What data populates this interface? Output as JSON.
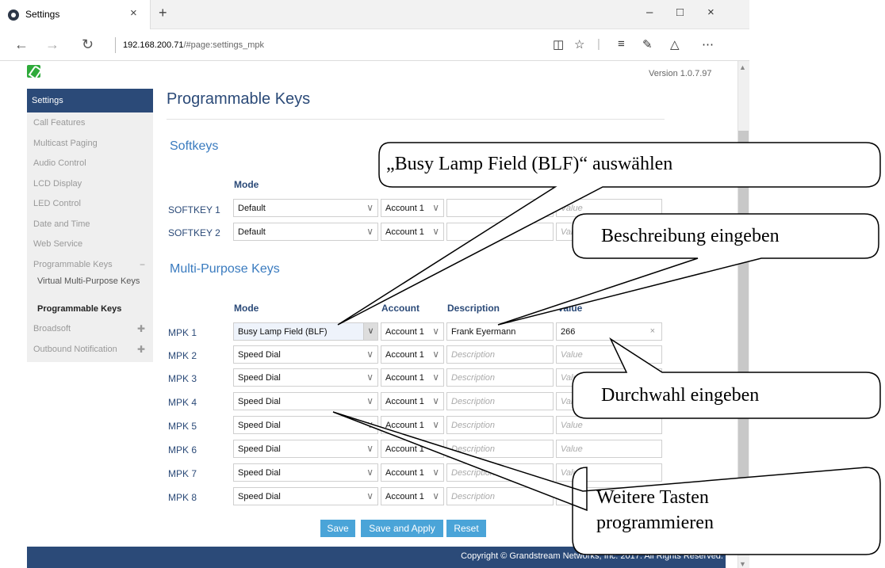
{
  "browser": {
    "tab_title": "Settings",
    "tab_close": "×",
    "new_tab": "+",
    "minimize": "–",
    "maximize": "□",
    "close": "×",
    "back": "←",
    "forward": "→",
    "refresh": "↻",
    "url_host": "192.168.200.71",
    "url_path": "/#page:settings_mpk",
    "icons": [
      "reading-view-icon",
      "favorite-star-icon",
      "hub-icon",
      "notes-icon",
      "share-icon",
      "more-icon"
    ]
  },
  "header": {
    "version": "Version 1.0.7.97"
  },
  "sidebar": {
    "title": "Settings",
    "items": [
      {
        "label": "Call Features"
      },
      {
        "label": "Multicast Paging"
      },
      {
        "label": "Audio Control"
      },
      {
        "label": "LCD Display"
      },
      {
        "label": "LED Control"
      },
      {
        "label": "Date and Time"
      },
      {
        "label": "Web Service"
      },
      {
        "label": "Programmable Keys",
        "toggle": "−"
      }
    ],
    "sub_items": [
      {
        "label": "Virtual Multi-Purpose Keys"
      },
      {
        "label": "Programmable Keys"
      }
    ],
    "after_items": [
      {
        "label": "Broadsoft",
        "toggle": "✚"
      },
      {
        "label": "Outbound Notification",
        "toggle": "✚"
      }
    ]
  },
  "main": {
    "title": "Programmable Keys",
    "softkeys": {
      "title": "Softkeys",
      "mode_header": "Mode",
      "rows": [
        {
          "label": "SOFTKEY 1",
          "mode": "Default",
          "account": "Account 1",
          "value_placeholder": "Value"
        },
        {
          "label": "SOFTKEY 2",
          "mode": "Default",
          "account": "Account 1",
          "value_placeholder": "Value"
        }
      ]
    },
    "mpk": {
      "title": "Multi-Purpose Keys",
      "headers": {
        "mode": "Mode",
        "account": "Account",
        "description": "Description",
        "value": "Value"
      },
      "rows": [
        {
          "label": "MPK 1",
          "mode": "Busy Lamp Field (BLF)",
          "account": "Account 1",
          "description": "Frank Eyermann",
          "value": "266"
        },
        {
          "label": "MPK 2",
          "mode": "Speed Dial",
          "account": "Account 1",
          "description_placeholder": "Description",
          "value_placeholder": "Value"
        },
        {
          "label": "MPK 3",
          "mode": "Speed Dial",
          "account": "Account 1",
          "description_placeholder": "Description",
          "value_placeholder": "Value"
        },
        {
          "label": "MPK 4",
          "mode": "Speed Dial",
          "account": "Account 1",
          "description_placeholder": "Description",
          "value_placeholder": "Value"
        },
        {
          "label": "MPK 5",
          "mode": "Speed Dial",
          "account": "Account 1",
          "description_placeholder": "Description",
          "value_placeholder": "Value"
        },
        {
          "label": "MPK 6",
          "mode": "Speed Dial",
          "account": "Account 1",
          "description_placeholder": "Description",
          "value_placeholder": "Value"
        },
        {
          "label": "MPK 7",
          "mode": "Speed Dial",
          "account": "Account 1",
          "description_placeholder": "Description",
          "value_placeholder": "Value"
        },
        {
          "label": "MPK 8",
          "mode": "Speed Dial",
          "account": "Account 1",
          "description_placeholder": "Description",
          "value_placeholder": "Value"
        }
      ]
    },
    "buttons": {
      "save": "Save",
      "save_apply": "Save and Apply",
      "reset": "Reset"
    }
  },
  "footer": {
    "copyright": "Copyright © Grandstream Networks, Inc. 2017. All Rights Reserved."
  },
  "callouts": {
    "blf": "„Busy Lamp Field (BLF)“ auswählen",
    "description": "Beschreibung eingeben",
    "extension": "Durchwahl eingeben",
    "more_line1": "Weitere Tasten",
    "more_line2": "programmieren"
  }
}
